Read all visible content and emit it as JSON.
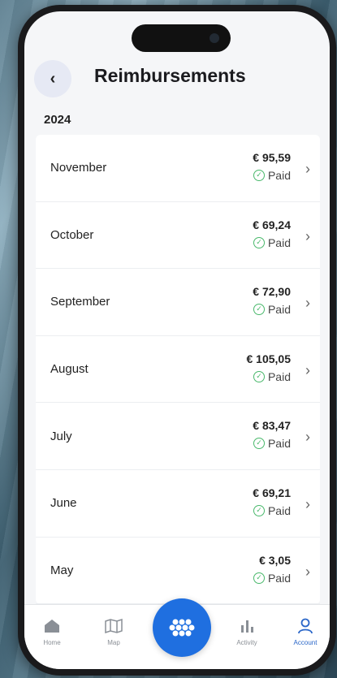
{
  "header": {
    "title": "Reimbursements",
    "back_icon": "‹"
  },
  "year": "2024",
  "rows": [
    {
      "month": "November",
      "amount": "€ 95,59",
      "status": "Paid"
    },
    {
      "month": "October",
      "amount": "€ 69,24",
      "status": "Paid"
    },
    {
      "month": "September",
      "amount": "€ 72,90",
      "status": "Paid"
    },
    {
      "month": "August",
      "amount": "€ 105,05",
      "status": "Paid"
    },
    {
      "month": "July",
      "amount": "€ 83,47",
      "status": "Paid"
    },
    {
      "month": "June",
      "amount": "€ 69,21",
      "status": "Paid"
    },
    {
      "month": "May",
      "amount": "€ 3,05",
      "status": "Paid"
    }
  ],
  "nav": {
    "home": "Home",
    "map": "Map",
    "activity": "Activity",
    "account": "Account"
  },
  "colors": {
    "accent": "#1f6fe0",
    "paid": "#49b86b"
  }
}
